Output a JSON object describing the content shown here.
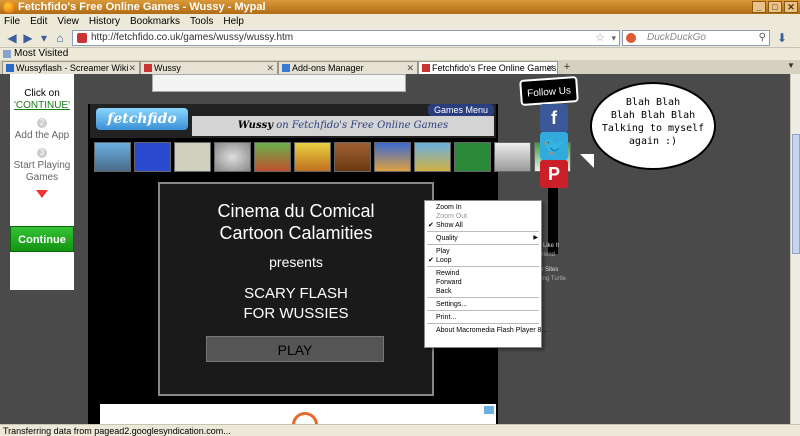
{
  "window": {
    "title": "Fetchfido's Free Online Games - Wussy - Mypal"
  },
  "menu": [
    "File",
    "Edit",
    "View",
    "History",
    "Bookmarks",
    "Tools",
    "Help"
  ],
  "nav": {
    "url": "http://fetchfido.co.uk/games/wussy/wussy.htm",
    "search_placeholder": "DuckDuckGo"
  },
  "bookmarks": {
    "most_visited": "Most Visited"
  },
  "tabs": [
    {
      "label": "Wussyflash - Screamer Wiki"
    },
    {
      "label": "Wussy"
    },
    {
      "label": "Add-ons Manager"
    },
    {
      "label": "Fetchfido's Free Online Games - Wussy"
    }
  ],
  "steps": {
    "click_on": "Click on",
    "continue_link": "'CONTINUE'",
    "step2_num": "2",
    "step2": "Add the App",
    "step3_num": "3",
    "step3": "Start Playing Games",
    "continue_button": "Continue"
  },
  "site": {
    "logo": "fetchfido",
    "games_menu": "Games Menu",
    "title_game": "Wussy",
    "title_rest": " on Fetchfido's Free Online Games"
  },
  "flash": {
    "line1": "Cinema du Comical",
    "line2": "Cartoon Calamities",
    "presents": "presents",
    "line3": "SCARY FLASH",
    "line4": "FOR WUSSIES",
    "play": "PLAY"
  },
  "context_menu": {
    "zoom_in": "Zoom In",
    "zoom_out": "Zoom Out",
    "show_all": "Show All",
    "quality": "Quality",
    "play": "Play",
    "loop": "Loop",
    "rewind": "Rewind",
    "forward": "Forward",
    "back": "Back",
    "settings": "Settings...",
    "print": "Print...",
    "about": "About Macromedia Flash Player 8..."
  },
  "social": {
    "follow_us": "Follow Us",
    "fb": "f",
    "pin": "P"
  },
  "sidebar_links": {
    "l1": "u Like It",
    "l2": "Friend",
    "l3": "er Sites",
    "l4": "ping Turtle"
  },
  "bubble": {
    "text1": "Blah Blah",
    "text2": "Blah Blah Blah",
    "text3": "Talking to myself",
    "text4": "again :)"
  },
  "status": "Transferring data from pagead2.googlesyndication.com...",
  "colors": {
    "titlebar": "#c7801f",
    "continue_green": "#149414",
    "games_menu": "#2a3e7e",
    "facebook": "#3b5998",
    "twitter": "#33aadd",
    "pinterest": "#cb2027"
  }
}
